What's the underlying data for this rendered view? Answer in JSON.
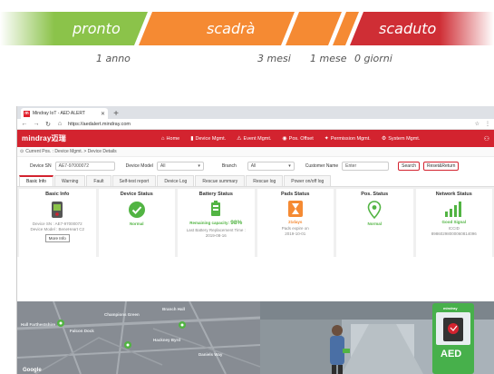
{
  "infographic": {
    "segments": [
      {
        "label": "pronto",
        "color": "#8bc34a"
      },
      {
        "label": "scadrà",
        "color": "#f58a33"
      },
      {
        "label": "scaduto",
        "color": "#cf2e35"
      }
    ],
    "ticks": [
      "1 anno",
      "3 mesi",
      "1 mese",
      "0 giorni"
    ]
  },
  "browser": {
    "tab_title": "Mindray IoT - AED ALERT",
    "tab_logo": "m",
    "url": "https://aedalert.mindray.com"
  },
  "app": {
    "brand": "mindray迈瑞",
    "nav": [
      {
        "label": "Home",
        "icon": "home-icon"
      },
      {
        "label": "Device Mgmt.",
        "icon": "device-icon"
      },
      {
        "label": "Event Mgmt.",
        "icon": "event-icon"
      },
      {
        "label": "Pos. Offset",
        "icon": "offset-icon"
      },
      {
        "label": "Permission Mgmt.",
        "icon": "permission-icon"
      },
      {
        "label": "System Mgmt.",
        "icon": "system-icon"
      }
    ],
    "breadcrumb": "Current Pos. : Device Mgmt. > Device Details",
    "filters": {
      "device_sn_label": "Device SN",
      "device_sn_value": "AE7-97000072",
      "device_model_label": "Device Model",
      "device_model_value": "All",
      "branch_label": "Branch",
      "branch_value": "All",
      "customer_label": "Customer Name",
      "customer_placeholder": "Enter",
      "search_label": "Search",
      "reset_label": "Reset&Return"
    },
    "tabs": [
      "Basic Info",
      "Warning",
      "Fault",
      "Self-test report",
      "Device Log",
      "Rescue summary",
      "Rescue log",
      "Power on/off log"
    ],
    "cards": {
      "basic": {
        "title": "Basic Info",
        "line1": "Device SN : AE7-97000072",
        "line2": "Device Model : BeneHeart C2",
        "more": "More Info"
      },
      "device": {
        "title": "Device Status",
        "value": "Normal"
      },
      "battery": {
        "title": "Battery Status",
        "value": "Remaining capacity: ",
        "percent": "98%",
        "line1": "Last Battery Replacement Time :",
        "line2": "2019-08-16"
      },
      "pads": {
        "title": "Pads Status",
        "value": "21days",
        "line1": "Pads expire on",
        "line2": "2019-10-01"
      },
      "pos": {
        "title": "Pos. Status",
        "value": "Normal"
      },
      "network": {
        "title": "Network Status",
        "value": "Good Signal",
        "line1": "ICCID",
        "line2": "89860298000060814096"
      }
    },
    "map": {
      "labels": [
        "Champions Green",
        "Falcon Dock",
        "Hall Farthestshire",
        "Hackney Byrd",
        "Daniels Way",
        "Branch Hall"
      ],
      "google": "Google"
    },
    "photo": {
      "aed": "AED",
      "brand": "mindray"
    }
  },
  "colors": {
    "brand_red": "#d3232f",
    "green": "#52b443",
    "orange": "#f58a33"
  }
}
